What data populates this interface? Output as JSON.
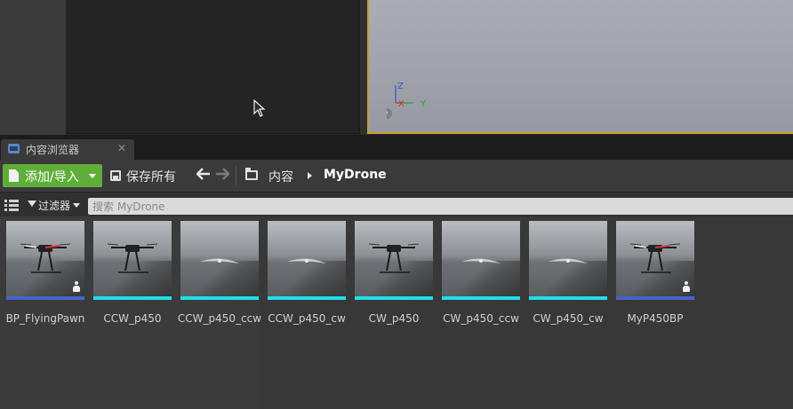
{
  "viewport": {
    "axis_labels": {
      "z": "Z",
      "x": "X",
      "y": "Y"
    },
    "accent_color": "#c79b3b"
  },
  "tab": {
    "label": "内容浏览器",
    "icon": "content-browser-icon",
    "close": "✕"
  },
  "toolbar": {
    "add_import_label": "添加/导入",
    "save_all_label": "保存所有",
    "back_arrow": "🡐",
    "forward_arrow": "🡒",
    "breadcrumb": [
      "内容",
      "MyDrone"
    ],
    "add_button_color": "#5fae3a"
  },
  "filter": {
    "label": "过滤器",
    "search_placeholder": "搜索 MyDrone"
  },
  "assets": [
    {
      "name": "BP_FlyingPawn",
      "type": "blueprint",
      "strip_color": "#4a63c9",
      "thumbnail": "drone-on-ground",
      "has_pawn_icon": true
    },
    {
      "name": "CCW_p450",
      "type": "static-mesh",
      "strip_color": "#1ee0e8",
      "thumbnail": "drone-on-ground",
      "has_pawn_icon": false
    },
    {
      "name": "CCW_p450_ccw",
      "type": "static-mesh",
      "strip_color": "#1ee0e8",
      "thumbnail": "propeller",
      "has_pawn_icon": false
    },
    {
      "name": "CCW_p450_cw",
      "type": "static-mesh",
      "strip_color": "#1ee0e8",
      "thumbnail": "propeller",
      "has_pawn_icon": false
    },
    {
      "name": "CW_p450",
      "type": "static-mesh",
      "strip_color": "#1ee0e8",
      "thumbnail": "drone-on-ground",
      "has_pawn_icon": false
    },
    {
      "name": "CW_p450_ccw",
      "type": "static-mesh",
      "strip_color": "#1ee0e8",
      "thumbnail": "propeller",
      "has_pawn_icon": false
    },
    {
      "name": "CW_p450_cw",
      "type": "static-mesh",
      "strip_color": "#1ee0e8",
      "thumbnail": "propeller",
      "has_pawn_icon": false
    },
    {
      "name": "MyP450BP",
      "type": "blueprint",
      "strip_color": "#4a63c9",
      "thumbnail": "drone-on-ground",
      "has_pawn_icon": true
    }
  ]
}
